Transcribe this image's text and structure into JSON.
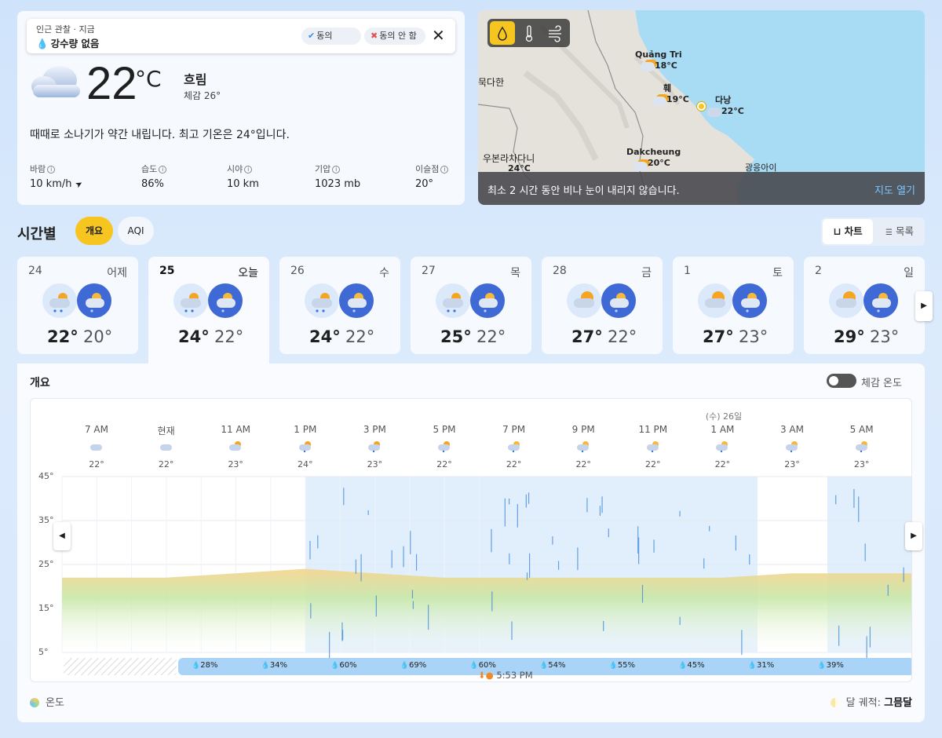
{
  "notification": {
    "source": "인근 관찰 · 지금",
    "headline": "강수량 없음",
    "agree_label": "동의",
    "disagree_label": "동의 안 함"
  },
  "current": {
    "temp": "22",
    "unit": "°C",
    "condition": "흐림",
    "feels_like": "체감   26°",
    "summary": "때때로 소나기가 약간 내립니다. 최고 기온은 24°입니다.",
    "stats": [
      {
        "label": "바람",
        "value": "10 km/h"
      },
      {
        "label": "습도",
        "value": "86%"
      },
      {
        "label": "시야",
        "value": "10 km"
      },
      {
        "label": "기압",
        "value": "1023 mb"
      },
      {
        "label": "이슬점",
        "value": "20°"
      }
    ]
  },
  "map": {
    "cities": [
      {
        "name": "Quảng Tri",
        "temp": "18°C"
      },
      {
        "name": "훼",
        "temp": "19°C"
      },
      {
        "name": "다낭",
        "temp": "22°C"
      },
      {
        "name": "묵다한",
        "temp": ""
      },
      {
        "name": "Dakcheung",
        "temp": "20°C"
      },
      {
        "name": "우본라차다니",
        "temp": "24°C"
      },
      {
        "name": "광응아이",
        "temp": ""
      }
    ],
    "banner_text": "최소 2 시간 동안 비나 눈이 내리지 않습니다.",
    "open_label": "지도 열기"
  },
  "hourly": {
    "title": "시간별",
    "tab_overview": "개요",
    "tab_aqi": "AQI",
    "view_chart": "차트",
    "view_list": "목록"
  },
  "days": [
    {
      "num": "24",
      "name": "어제",
      "hi": "22°",
      "lo": "20°"
    },
    {
      "num": "25",
      "name": "오늘",
      "hi": "24°",
      "lo": "22°"
    },
    {
      "num": "26",
      "name": "수",
      "hi": "24°",
      "lo": "22°"
    },
    {
      "num": "27",
      "name": "목",
      "hi": "25°",
      "lo": "22°"
    },
    {
      "num": "28",
      "name": "금",
      "hi": "27°",
      "lo": "22°"
    },
    {
      "num": "1",
      "name": "토",
      "hi": "27°",
      "lo": "23°"
    },
    {
      "num": "2",
      "name": "일",
      "hi": "29°",
      "lo": "23°"
    }
  ],
  "panel": {
    "title": "개요",
    "feels_toggle_label": "체감 온도",
    "sunset": "5:53 PM",
    "day_marker": "(수) 26일",
    "legend_temp": "온도",
    "moon_label": "달 궤적:",
    "moon_phase": "그믐달"
  },
  "chart_data": {
    "type": "area",
    "x": [
      "7 AM",
      "현재",
      "11 AM",
      "1 PM",
      "3 PM",
      "5 PM",
      "7 PM",
      "9 PM",
      "11 PM",
      "1 AM",
      "3 AM",
      "5 AM"
    ],
    "temps_label": [
      "22°",
      "22°",
      "23°",
      "24°",
      "23°",
      "22°",
      "22°",
      "22°",
      "22°",
      "22°",
      "23°",
      "23°"
    ],
    "y": [
      22,
      22,
      23,
      24,
      23,
      22,
      22,
      22,
      22,
      22,
      23,
      23
    ],
    "y_ticks": [
      "45°",
      "35°",
      "25°",
      "15°",
      "5°"
    ],
    "ylim": [
      5,
      45
    ],
    "precip_chance": [
      "28%",
      "34%",
      "60%",
      "69%",
      "60%",
      "54%",
      "55%",
      "45%",
      "31%",
      "39%"
    ]
  },
  "colors": {
    "accent": "#f7c520",
    "precip_bar": "#a9d4f7",
    "rain_band": "#dcecfb"
  }
}
